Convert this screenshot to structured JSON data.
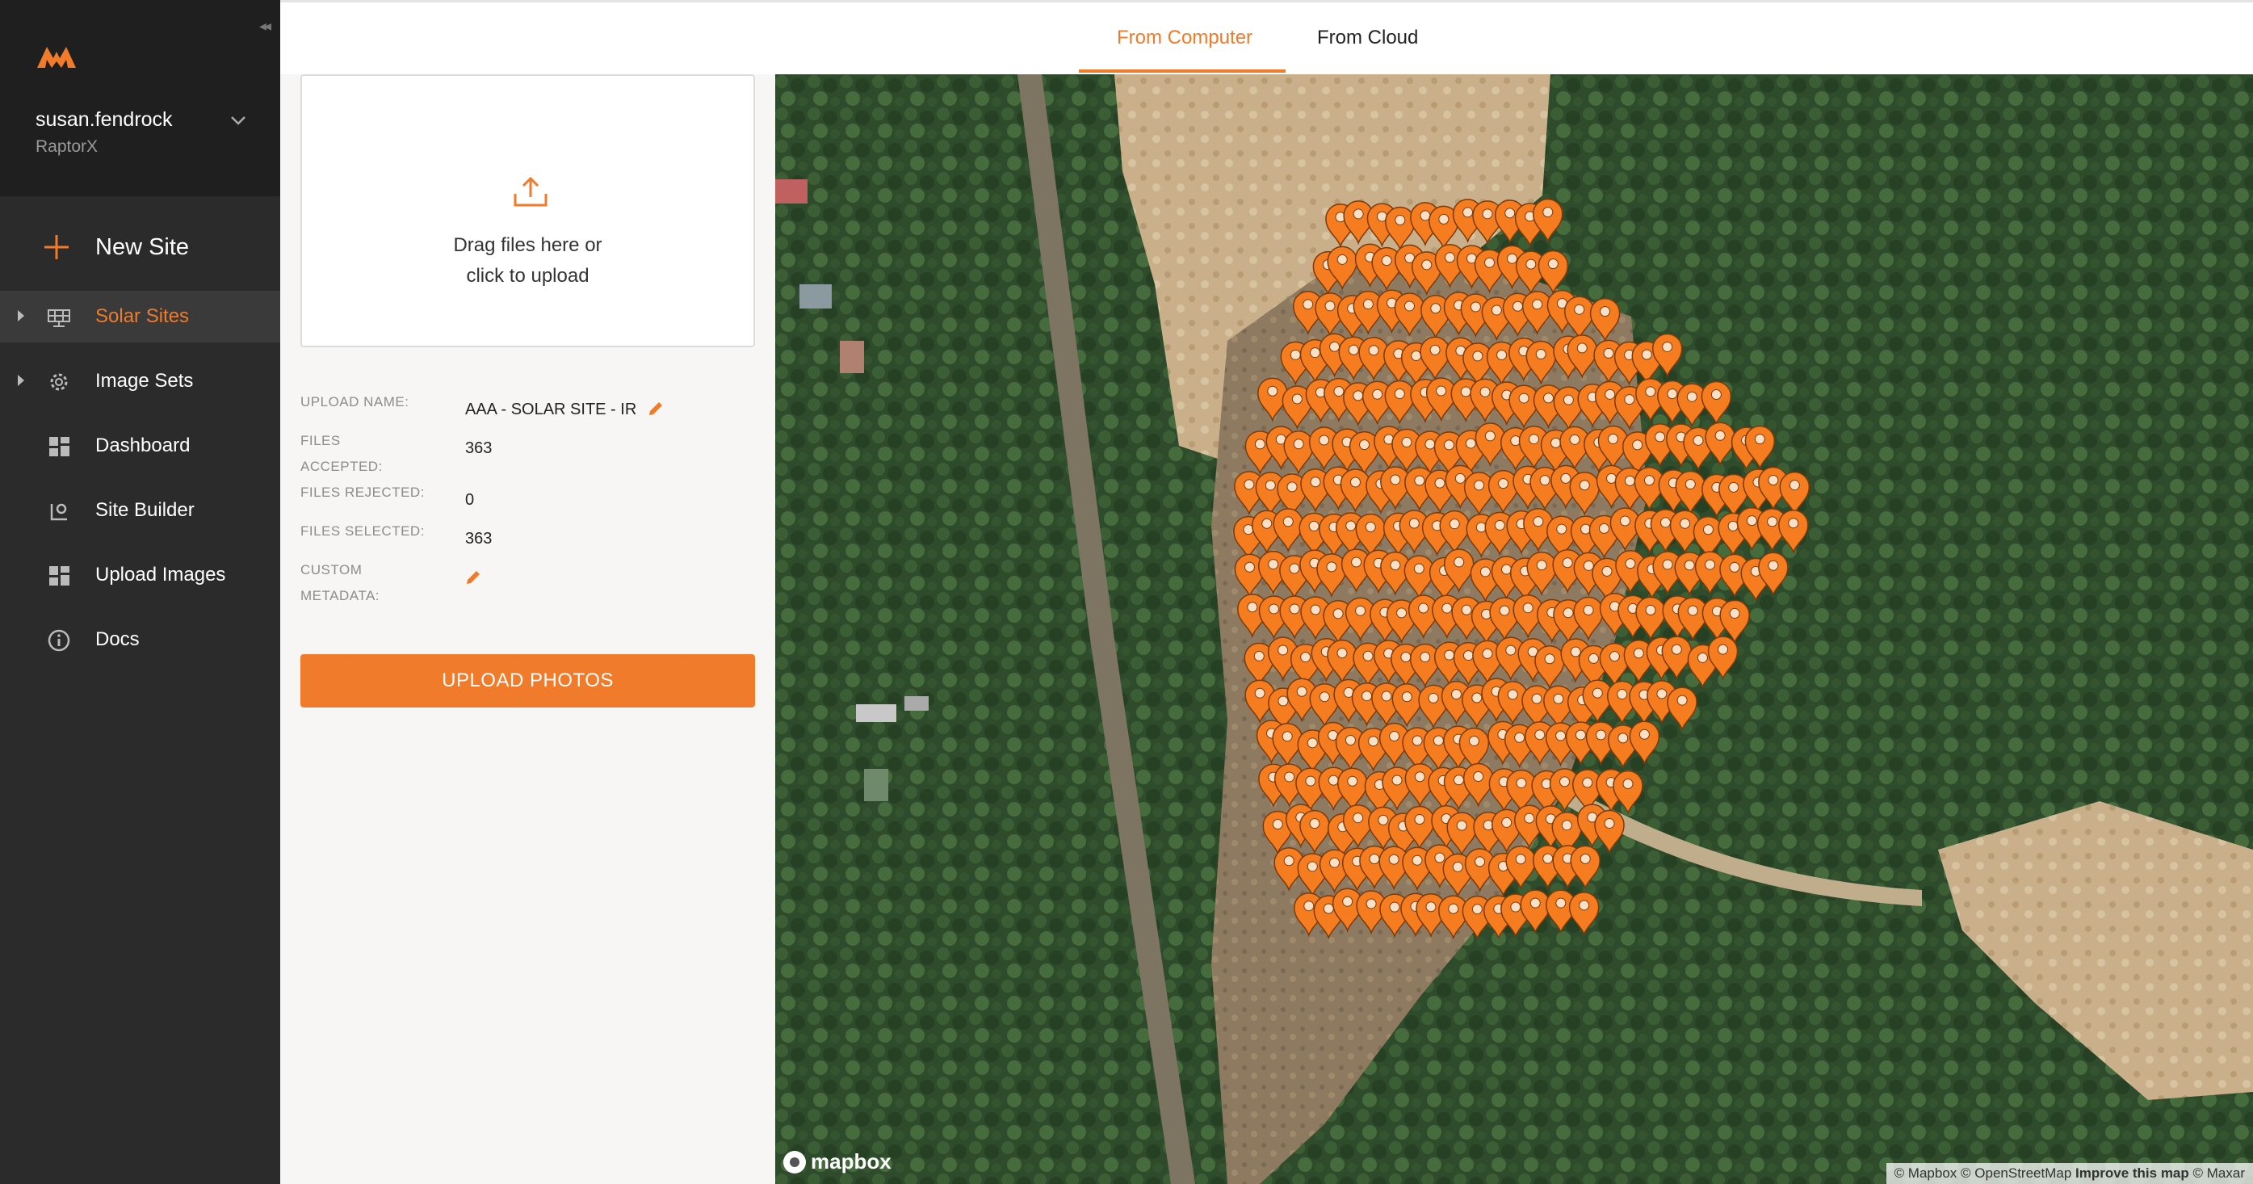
{
  "app": {
    "accent_color": "#f07b2a",
    "sidebar_bg": "#2b2b2b"
  },
  "user": {
    "name": "susan.fendrock",
    "org": "RaptorX"
  },
  "sidebar": {
    "new_site_label": "New Site",
    "items": [
      {
        "label": "Solar Sites",
        "icon": "solar-panel-icon",
        "active": true,
        "expandable": true
      },
      {
        "label": "Image Sets",
        "icon": "gear-icon",
        "active": false,
        "expandable": true
      },
      {
        "label": "Dashboard",
        "icon": "dashboard-grid-icon",
        "active": false,
        "expandable": false
      },
      {
        "label": "Site Builder",
        "icon": "site-builder-icon",
        "active": false,
        "expandable": false
      },
      {
        "label": "Upload Images",
        "icon": "upload-grid-icon",
        "active": false,
        "expandable": false
      },
      {
        "label": "Docs",
        "icon": "info-icon",
        "active": false,
        "expandable": false
      }
    ]
  },
  "tabs": [
    {
      "label": "From Computer",
      "active": true
    },
    {
      "label": "From Cloud",
      "active": false
    }
  ],
  "upload": {
    "drop_line1": "Drag files here or",
    "drop_line2": "click to upload",
    "upload_name_label": "UPLOAD NAME:",
    "upload_name_value": "AAA - SOLAR SITE - IR",
    "files_accepted_label_1": "FILES",
    "files_accepted_label_2": "ACCEPTED:",
    "files_accepted_value": "363",
    "files_rejected_label": "FILES REJECTED:",
    "files_rejected_value": "0",
    "files_selected_label": "FILES SELECTED:",
    "files_selected_value": "363",
    "custom_metadata_label_1": "CUSTOM",
    "custom_metadata_label_2": "METADATA:",
    "button_label": "UPLOAD PHOTOS"
  },
  "map": {
    "provider_logo": "mapbox",
    "attribution_1": "© Mapbox © OpenStreetMap",
    "attribution_link": "Improve this map",
    "attribution_2": "© Maxar",
    "marker_color": "#f57c1f"
  }
}
